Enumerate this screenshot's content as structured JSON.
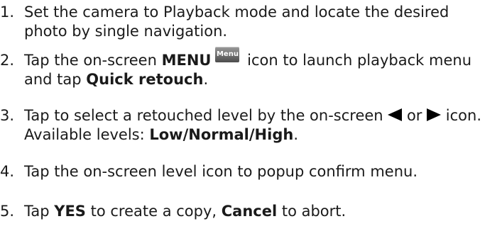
{
  "steps": [
    {
      "number": "1.",
      "line1": "Set the camera to Playback mode and locate the desired",
      "line2": "photo by single navigation."
    },
    {
      "number": "2.",
      "pre": "Tap the on-screen ",
      "bold1": "MENU",
      "icon_text": "Menu",
      "post": " icon to launch playback menu",
      "line2_pre": "and tap ",
      "line2_bold": "Quick retouch",
      "line2_post": "."
    },
    {
      "number": "3.",
      "pre": "Tap to select a retouched level by the on-screen ",
      "mid": " or ",
      "post": " icon.",
      "line2_pre": "Available levels: ",
      "level_low": "Low",
      "sep1": "/",
      "level_normal": "Normal",
      "sep2": "/",
      "level_high": "High",
      "line2_post": "."
    },
    {
      "number": "4.",
      "line1": "Tap the on-screen level icon to popup confirm menu."
    },
    {
      "number": "5.",
      "pre": "Tap ",
      "bold1": "YES",
      "mid": " to create a copy, ",
      "bold2": "Cancel",
      "post": " to abort."
    }
  ],
  "icons": {
    "menu_icon": "menu-icon",
    "left_icon": "left-triangle-icon",
    "right_icon": "right-triangle-icon"
  }
}
